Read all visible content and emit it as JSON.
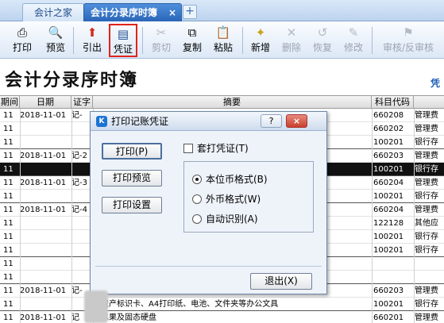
{
  "tabs": {
    "home": "会计之家",
    "journal": "会计分录序时簿",
    "journal_close": "×",
    "new_tab": "+"
  },
  "toolbar": {
    "print": {
      "icon": "printer-icon",
      "label": "打印"
    },
    "preview": {
      "icon": "preview-icon",
      "label": "预览"
    },
    "export": {
      "icon": "export-icon",
      "label": "引出"
    },
    "voucher": {
      "icon": "voucher-print-icon",
      "label": "凭证"
    },
    "cut": {
      "icon": "scissors-icon",
      "label": "剪切"
    },
    "copy": {
      "icon": "copy-icon",
      "label": "复制"
    },
    "paste": {
      "icon": "paste-icon",
      "label": "粘贴"
    },
    "add": {
      "icon": "add-icon",
      "label": "新增"
    },
    "delete": {
      "icon": "delete-icon",
      "label": "删除"
    },
    "restore": {
      "icon": "restore-icon",
      "label": "恢复"
    },
    "modify": {
      "icon": "modify-icon",
      "label": "修改"
    },
    "audit": {
      "icon": "audit-icon",
      "label": "审核/反审核"
    }
  },
  "page": {
    "title": "会计分录序时簿",
    "link": "凭"
  },
  "table": {
    "headers": {
      "period": "期间",
      "date": "日期",
      "vno": "证字",
      "summary": "摘要",
      "code": "科目代码"
    },
    "rows": [
      {
        "period": "11",
        "date": "2018-11-01",
        "vno": "记-",
        "summary": "",
        "code": "660208",
        "acct": "管理费"
      },
      {
        "period": "11",
        "date": "",
        "vno": "",
        "summary": "",
        "code": "660202",
        "acct": "管理费"
      },
      {
        "period": "11",
        "date": "",
        "vno": "",
        "summary": "",
        "code": "100201",
        "acct": "银行存"
      },
      {
        "period": "11",
        "date": "2018-11-01",
        "vno": "记-2",
        "summary": "",
        "code": "660203",
        "acct": "管理费"
      },
      {
        "period": "11",
        "date": "",
        "vno": "",
        "summary": "",
        "code": "100201",
        "acct": "银行存"
      },
      {
        "period": "11",
        "date": "2018-11-01",
        "vno": "记-3",
        "summary": "",
        "code": "660204",
        "acct": "管理费"
      },
      {
        "period": "11",
        "date": "",
        "vno": "",
        "summary": "",
        "code": "100201",
        "acct": "银行存"
      },
      {
        "period": "11",
        "date": "2018-11-01",
        "vno": "记-4",
        "summary": "",
        "code": "660204",
        "acct": "管理费"
      },
      {
        "period": "11",
        "date": "",
        "vno": "",
        "summary": "",
        "code": "122128",
        "acct": "其他应"
      },
      {
        "period": "11",
        "date": "",
        "vno": "",
        "summary": "",
        "code": "100201",
        "acct": "银行存"
      },
      {
        "period": "11",
        "date": "",
        "vno": "",
        "summary": "",
        "code": "100201",
        "acct": "银行存"
      },
      {
        "period": "11",
        "date": "",
        "vno": "",
        "summary": "",
        "code": "",
        "acct": ""
      },
      {
        "period": "11",
        "date": "",
        "vno": "",
        "summary": "",
        "code": "",
        "acct": ""
      },
      {
        "period": "11",
        "date": "2018-11-01",
        "vno": "记-",
        "summary": "买资产标识卡、A4打印纸、电池、文件夹等办公文具",
        "code": "660203",
        "acct": "管理费"
      },
      {
        "period": "11",
        "date": "",
        "vno": "",
        "summary": "买资产标识卡、A4打印纸、电池、文件夹等办公文具",
        "code": "100201",
        "acct": "银行存"
      },
      {
        "period": "11",
        "date": "2018-11-01",
        "vno": "记",
        "summary": "买水果及固态硬盘",
        "code": "660201",
        "acct": "管理费"
      },
      {
        "period": "11",
        "date": "",
        "vno": "",
        "summary": "买水果及固态硬盘",
        "code": "100201",
        "acct": "银行存"
      }
    ]
  },
  "dialog": {
    "title": "打印记账凭证",
    "help": "?",
    "close": "×",
    "print_button": "打印(P)",
    "preview_button": "打印预览",
    "setup_button": "打印设置",
    "overprint_checkbox": "套打凭证(T)",
    "overprint_checked": false,
    "format_options": [
      "本位币格式(B)",
      "外币格式(W)",
      "自动识别(A)"
    ],
    "selected_format": "本位币格式(B)",
    "exit_button": "退出(X)"
  }
}
